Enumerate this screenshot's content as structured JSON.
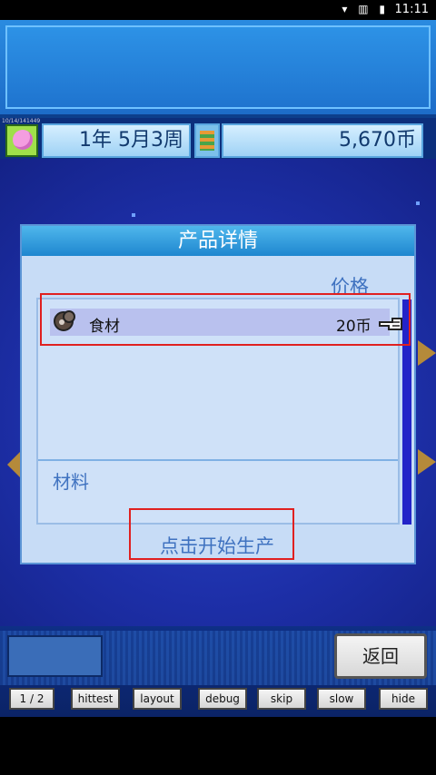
{
  "status_bar": {
    "time": "11:11",
    "icons": "▾ ▥ ▮"
  },
  "top_info": {
    "tiny_label": "10/14/141449",
    "date": "1年 5月3周",
    "money": "5,670币"
  },
  "dialog": {
    "title": "产品详情",
    "price_header": "价格",
    "items": [
      {
        "name": "食材",
        "price": "20币"
      }
    ],
    "material_label": "材料",
    "start_button": "点击开始生产"
  },
  "bottom": {
    "back_button": "返回",
    "debug_buttons": [
      "1 / 2",
      "hittest",
      "layout",
      "debug",
      "skip",
      "slow",
      "hide"
    ]
  },
  "colors": {
    "accent": "#1e86cf",
    "highlight": "#e02020",
    "background": "#1d2fa8"
  }
}
